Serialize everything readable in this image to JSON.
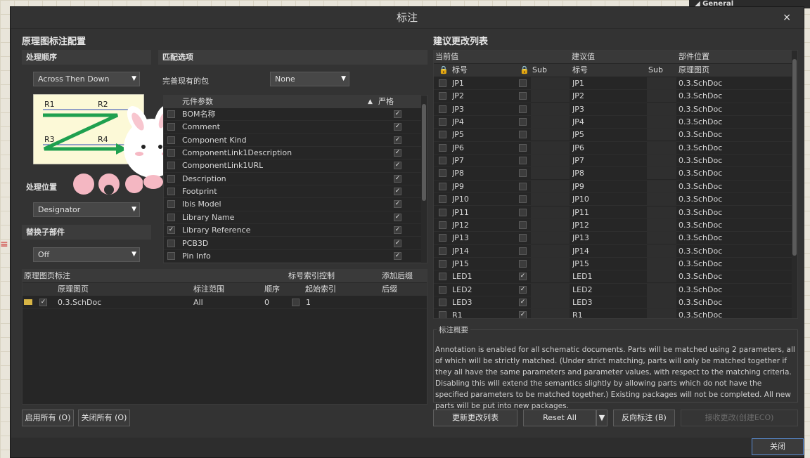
{
  "window": {
    "title": "标注",
    "close_glyph": "×"
  },
  "background": {
    "right_panel_label": "◢ General",
    "edge_mark": "≡"
  },
  "left": {
    "heading": "原理图标注配置",
    "order_section": "处理顺序",
    "order_value": "Across Then Down",
    "diagram_labels": [
      "R1",
      "R2",
      "R3",
      "R4"
    ],
    "location_section": "处理位置",
    "location_value": "Designator",
    "subparts_section": "替换子部件",
    "subparts_value": "Off",
    "match_section": "匹配选项",
    "complete_label": "完善现有的包",
    "complete_value": "None",
    "param_headers": {
      "param": "元件参数",
      "strict": "严格"
    },
    "params": [
      {
        "name": "BOM名称",
        "checked": false,
        "strict": true
      },
      {
        "name": "Comment",
        "checked": false,
        "strict": true
      },
      {
        "name": "Component Kind",
        "checked": false,
        "strict": true
      },
      {
        "name": "ComponentLink1Description",
        "checked": false,
        "strict": true
      },
      {
        "name": "ComponentLink1URL",
        "checked": false,
        "strict": true
      },
      {
        "name": "Description",
        "checked": false,
        "strict": true
      },
      {
        "name": "Footprint",
        "checked": false,
        "strict": true
      },
      {
        "name": "Ibis Model",
        "checked": false,
        "strict": true
      },
      {
        "name": "Library Name",
        "checked": false,
        "strict": true
      },
      {
        "name": "Library Reference",
        "checked": true,
        "strict": true
      },
      {
        "name": "PCB3D",
        "checked": false,
        "strict": true
      },
      {
        "name": "Pin Info",
        "checked": false,
        "strict": true
      }
    ],
    "sheet_table": {
      "group_headers": {
        "sheets": "原理图页标注",
        "index": "标号索引控制",
        "suffix": "添加后缀"
      },
      "headers": {
        "sheet": "原理图页",
        "scope": "标注范围",
        "order": "顺序",
        "start": "起始索引",
        "suffix": "后缀"
      },
      "rows": [
        {
          "sheet": "0.3.SchDoc",
          "scope": "All",
          "order": "0",
          "start": "1",
          "suffix": ""
        }
      ]
    },
    "enable_all": "启用所有 (O)",
    "disable_all": "关闭所有 (O)"
  },
  "right": {
    "heading": "建议更改列表",
    "group_headers": {
      "current": "当前值",
      "proposed": "建议值",
      "location": "部件位置"
    },
    "headers": {
      "designator": "标号",
      "sub": "Sub",
      "new_designator": "标号",
      "new_sub": "Sub",
      "sheet": "原理图页"
    },
    "rows": [
      {
        "cur": "JP1",
        "lock": false,
        "new": "JP1",
        "sheet": "0.3.SchDoc"
      },
      {
        "cur": "JP2",
        "lock": false,
        "new": "JP2",
        "sheet": "0.3.SchDoc"
      },
      {
        "cur": "JP3",
        "lock": false,
        "new": "JP3",
        "sheet": "0.3.SchDoc"
      },
      {
        "cur": "JP4",
        "lock": false,
        "new": "JP4",
        "sheet": "0.3.SchDoc"
      },
      {
        "cur": "JP5",
        "lock": false,
        "new": "JP5",
        "sheet": "0.3.SchDoc"
      },
      {
        "cur": "JP6",
        "lock": false,
        "new": "JP6",
        "sheet": "0.3.SchDoc"
      },
      {
        "cur": "JP7",
        "lock": false,
        "new": "JP7",
        "sheet": "0.3.SchDoc"
      },
      {
        "cur": "JP8",
        "lock": false,
        "new": "JP8",
        "sheet": "0.3.SchDoc"
      },
      {
        "cur": "JP9",
        "lock": false,
        "new": "JP9",
        "sheet": "0.3.SchDoc"
      },
      {
        "cur": "JP10",
        "lock": false,
        "new": "JP10",
        "sheet": "0.3.SchDoc"
      },
      {
        "cur": "JP11",
        "lock": false,
        "new": "JP11",
        "sheet": "0.3.SchDoc"
      },
      {
        "cur": "JP12",
        "lock": false,
        "new": "JP12",
        "sheet": "0.3.SchDoc"
      },
      {
        "cur": "JP13",
        "lock": false,
        "new": "JP13",
        "sheet": "0.3.SchDoc"
      },
      {
        "cur": "JP14",
        "lock": false,
        "new": "JP14",
        "sheet": "0.3.SchDoc"
      },
      {
        "cur": "JP15",
        "lock": false,
        "new": "JP15",
        "sheet": "0.3.SchDoc"
      },
      {
        "cur": "LED1",
        "lock": true,
        "new": "LED1",
        "sheet": "0.3.SchDoc"
      },
      {
        "cur": "LED2",
        "lock": true,
        "new": "LED2",
        "sheet": "0.3.SchDoc"
      },
      {
        "cur": "LED3",
        "lock": true,
        "new": "LED3",
        "sheet": "0.3.SchDoc"
      },
      {
        "cur": "R1",
        "lock": true,
        "new": "R1",
        "sheet": "0.3.SchDoc"
      }
    ],
    "summary_title": "标注概要",
    "summary_text": "Annotation is enabled for all schematic documents. Parts will be matched using 2 parameters, all of which will be strictly matched. (Under strict matching, parts will only be matched together if they all have the same parameters and parameter values, with respect to the matching criteria. Disabling this will extend the semantics slightly by allowing parts which do not have the specified parameters to be matched together.) Existing packages will not be completed. All new parts will be put into new packages.",
    "update_btn": "更新更改列表",
    "reset_btn": "Reset All",
    "back_btn": "反向标注 (B)",
    "accept_btn": "接收更改(创建ECO)"
  },
  "footer": {
    "close_btn": "关闭"
  },
  "colors": {
    "arrow": "#1fa04f",
    "accent": "#5c8fd6"
  }
}
